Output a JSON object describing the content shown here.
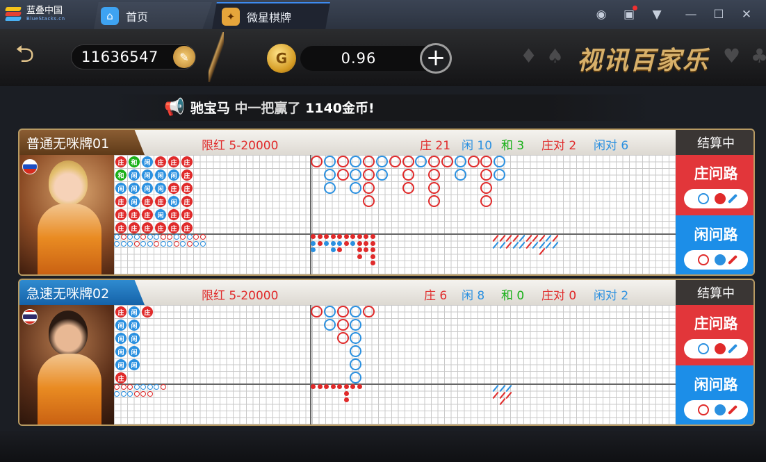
{
  "titlebar": {
    "app_name": "蓝叠中国",
    "app_sub": "BlueStacks.cn",
    "tabs": [
      {
        "label": "首页"
      },
      {
        "label": "微星棋牌"
      }
    ],
    "icons": [
      "account-icon",
      "gift-icon",
      "menu-down-icon",
      "minimize-icon",
      "maximize-icon",
      "close-icon"
    ]
  },
  "top": {
    "player_id": "11636547",
    "balance": "0.96",
    "game_title": "视讯百家乐",
    "coin_letter": "G"
  },
  "notice": {
    "prefix": "驰宝马",
    "middle": " 中一把赢了 ",
    "amount": "1140金币",
    "suffix": "!"
  },
  "tables": [
    {
      "name": "普通无咪牌01",
      "limit": "限红 5-20000",
      "banker": "庄 21",
      "player": "闲 10",
      "tie": "和 3",
      "banker_pair": "庄对 2",
      "player_pair": "闲对 6",
      "status": "结算中",
      "banker_road": "庄问路",
      "player_road": "闲问路",
      "flag": "russia"
    },
    {
      "name": "急速无咪牌02",
      "limit": "限红 5-20000",
      "banker": "庄 6",
      "player": "闲 8",
      "tie": "和 0",
      "banker_pair": "庄对 0",
      "player_pair": "闲对 2",
      "status": "结算中",
      "banker_road": "庄问路",
      "player_road": "闲问路",
      "flag": "thailand"
    }
  ],
  "bead_labels": {
    "banker": "庄",
    "player": "闲",
    "tie": "和"
  },
  "colors": {
    "banker": "#e02a2a",
    "player": "#2a90e0",
    "tie": "#19b019",
    "gold": "#d7b06a"
  }
}
